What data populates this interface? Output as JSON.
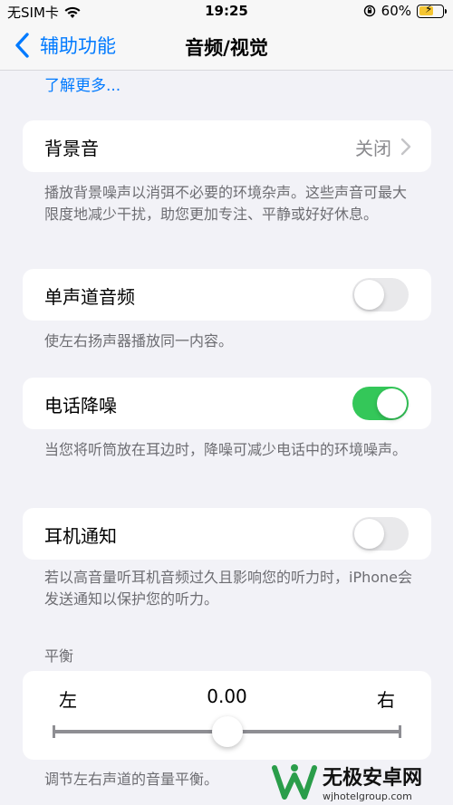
{
  "status_bar": {
    "carrier": "无SIM卡",
    "time": "19:25",
    "battery_percent": "60%",
    "battery_level": 0.6,
    "battery_color": "#f5c531"
  },
  "nav": {
    "back_label": "辅助功能",
    "title": "音频/视觉"
  },
  "learn_more": "了解更多...",
  "background_sound": {
    "label": "背景音",
    "value": "关闭",
    "footer": "播放背景噪声以消弭不必要的环境杂声。这些声音可最大限度地减少干扰，助您更加专注、平静或好好休息。"
  },
  "mono_audio": {
    "label": "单声道音频",
    "on": false,
    "footer": "使左右扬声器播放同一内容。"
  },
  "phone_noise": {
    "label": "电话降噪",
    "on": true,
    "footer": "当您将听筒放在耳边时，降噪可减少电话中的环境噪声。"
  },
  "headphone_notifications": {
    "label": "耳机通知",
    "on": false,
    "footer": "若以高音量听耳机音频过久且影响您的听力时，iPhone会发送通知以保护您的听力。"
  },
  "balance": {
    "header": "平衡",
    "left_label": "左",
    "right_label": "右",
    "value": "0.00",
    "position": 0.5,
    "footer": "调节左右声道的音量平衡。"
  },
  "watermark": {
    "title": "无极安卓网",
    "url": "wjhotelgroup.com"
  },
  "colors": {
    "accent": "#007aff",
    "toggle_on": "#34c759",
    "toggle_off": "#e9e9eb",
    "background": "#f2f2f7"
  }
}
